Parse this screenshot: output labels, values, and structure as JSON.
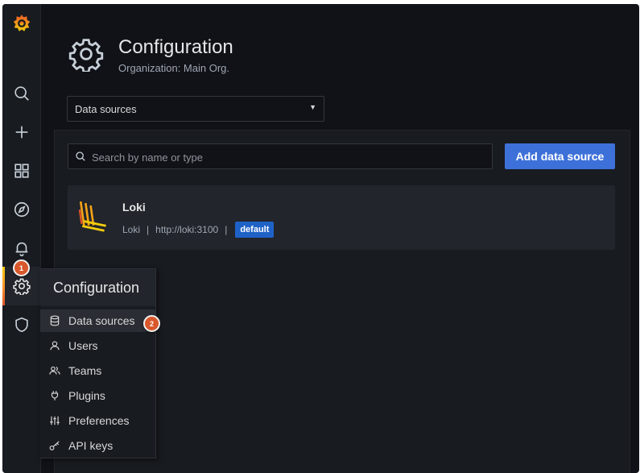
{
  "header": {
    "title": "Configuration",
    "subtitle": "Organization: Main Org."
  },
  "section_select": {
    "value": "Data sources"
  },
  "search": {
    "placeholder": "Search by name or type",
    "value": ""
  },
  "add_button": {
    "label": "Add data source"
  },
  "datasource": {
    "name": "Loki",
    "type": "Loki",
    "url": "http://loki:3100",
    "separator": "|",
    "badge": "default"
  },
  "sidebar": {
    "icons": [
      "grafana-logo-icon",
      "search-icon",
      "plus-icon",
      "dashboards-icon",
      "explore-icon",
      "alerting-icon",
      "gear-icon",
      "shield-icon"
    ],
    "active": "gear-icon"
  },
  "flyout": {
    "title": "Configuration",
    "items": [
      {
        "label": "Data sources",
        "icon": "database-icon"
      },
      {
        "label": "Users",
        "icon": "user-icon"
      },
      {
        "label": "Teams",
        "icon": "users-icon"
      },
      {
        "label": "Plugins",
        "icon": "plug-icon"
      },
      {
        "label": "Preferences",
        "icon": "sliders-icon"
      },
      {
        "label": "API keys",
        "icon": "key-icon"
      }
    ]
  },
  "annotations": {
    "step1": "1",
    "step2": "2"
  },
  "colors": {
    "accent": "#3d71d9",
    "badge_default": "#1f62c7",
    "step_badge": "#d8572b",
    "background": "#111217"
  }
}
